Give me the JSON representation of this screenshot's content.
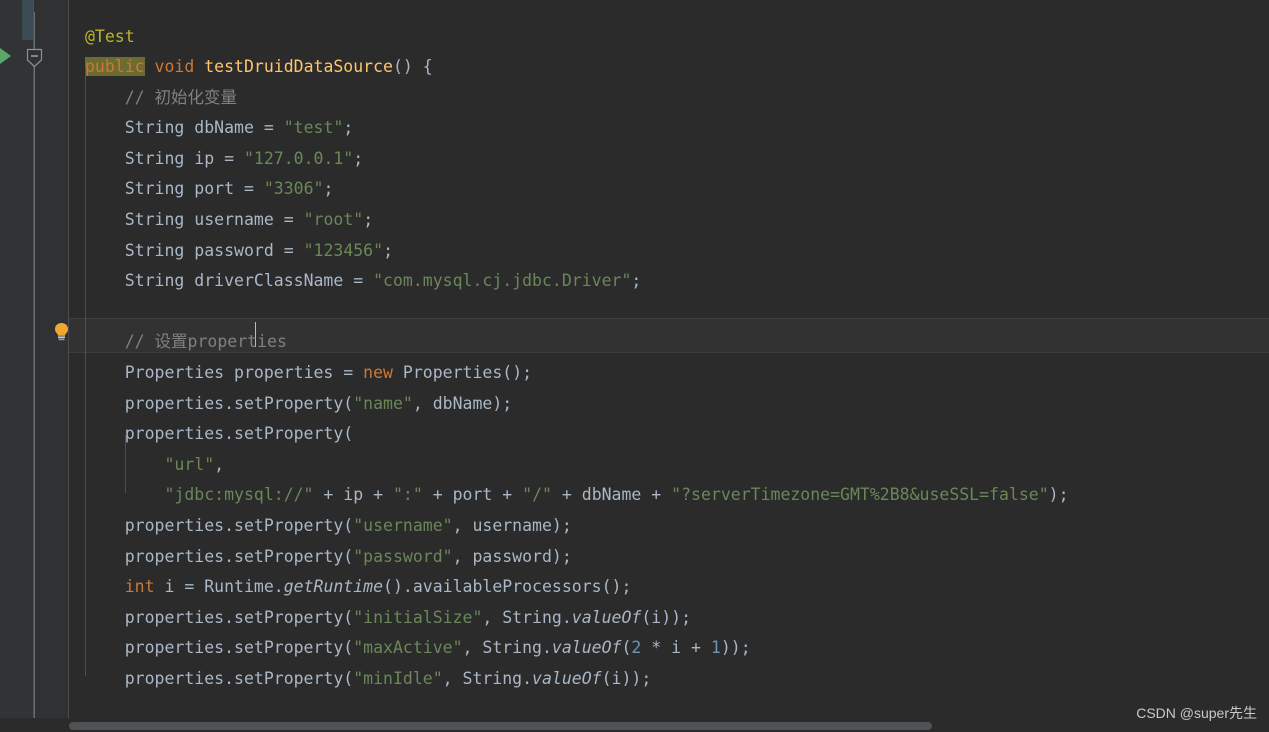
{
  "app": {
    "name": "IntelliJ IDEA Editor",
    "theme": "Darcula",
    "language": "Java"
  },
  "watermark": {
    "text": "CSDN @super先生"
  },
  "gutter": {
    "run_marker": "run-test-gutter-icon",
    "fold_marker": "collapse-method-fold-icon",
    "intention_bulb": "intention-lightbulb-icon",
    "annotation_block": "vcs-change-marker"
  },
  "caret": {
    "line_text": "    // 设置properties",
    "column_after": "properties"
  },
  "editor": {
    "lines": [
      {
        "n": 1,
        "indent": 0,
        "tokens": [
          {
            "t": "@Test",
            "c": "anno"
          }
        ]
      },
      {
        "n": 2,
        "indent": 0,
        "tokens": [
          {
            "t": "public",
            "c": "kw hl"
          },
          {
            "t": " ",
            "c": "plain"
          },
          {
            "t": "void",
            "c": "kw"
          },
          {
            "t": " ",
            "c": "plain"
          },
          {
            "t": "testDruidDataSource",
            "c": "mname"
          },
          {
            "t": "()",
            "c": "paren"
          },
          {
            "t": " {",
            "c": "plain"
          }
        ]
      },
      {
        "n": 3,
        "indent": 1,
        "tokens": [
          {
            "t": "// 初始化变量",
            "c": "cmt"
          }
        ]
      },
      {
        "n": 4,
        "indent": 1,
        "tokens": [
          {
            "t": "String",
            "c": "type"
          },
          {
            "t": " dbName = ",
            "c": "plain"
          },
          {
            "t": "\"test\"",
            "c": "str"
          },
          {
            "t": ";",
            "c": "plain"
          }
        ]
      },
      {
        "n": 5,
        "indent": 1,
        "tokens": [
          {
            "t": "String",
            "c": "type"
          },
          {
            "t": " ip = ",
            "c": "plain"
          },
          {
            "t": "\"127.0.0.1\"",
            "c": "str"
          },
          {
            "t": ";",
            "c": "plain"
          }
        ]
      },
      {
        "n": 6,
        "indent": 1,
        "tokens": [
          {
            "t": "String",
            "c": "type"
          },
          {
            "t": " port = ",
            "c": "plain"
          },
          {
            "t": "\"3306\"",
            "c": "str"
          },
          {
            "t": ";",
            "c": "plain"
          }
        ]
      },
      {
        "n": 7,
        "indent": 1,
        "tokens": [
          {
            "t": "String",
            "c": "type"
          },
          {
            "t": " username = ",
            "c": "plain"
          },
          {
            "t": "\"root\"",
            "c": "str"
          },
          {
            "t": ";",
            "c": "plain"
          }
        ]
      },
      {
        "n": 8,
        "indent": 1,
        "tokens": [
          {
            "t": "String",
            "c": "type"
          },
          {
            "t": " password = ",
            "c": "plain"
          },
          {
            "t": "\"123456\"",
            "c": "str"
          },
          {
            "t": ";",
            "c": "plain"
          }
        ]
      },
      {
        "n": 9,
        "indent": 1,
        "tokens": [
          {
            "t": "String",
            "c": "type"
          },
          {
            "t": " driverClassName = ",
            "c": "plain"
          },
          {
            "t": "\"com.mysql.cj.jdbc.Driver\"",
            "c": "str"
          },
          {
            "t": ";",
            "c": "plain"
          }
        ]
      },
      {
        "n": 10,
        "indent": 1,
        "tokens": []
      },
      {
        "n": 11,
        "indent": 1,
        "tokens": [
          {
            "t": "// 设置properties",
            "c": "cmt"
          }
        ]
      },
      {
        "n": 12,
        "indent": 1,
        "tokens": [
          {
            "t": "Properties",
            "c": "type"
          },
          {
            "t": " properties = ",
            "c": "plain"
          },
          {
            "t": "new",
            "c": "kw"
          },
          {
            "t": " Properties",
            "c": "plain"
          },
          {
            "t": "()",
            "c": "paren"
          },
          {
            "t": ";",
            "c": "plain"
          }
        ]
      },
      {
        "n": 13,
        "indent": 1,
        "tokens": [
          {
            "t": "properties.setProperty",
            "c": "plain"
          },
          {
            "t": "(",
            "c": "paren"
          },
          {
            "t": "\"name\"",
            "c": "str"
          },
          {
            "t": ", dbName",
            "c": "plain"
          },
          {
            "t": ")",
            "c": "paren"
          },
          {
            "t": ";",
            "c": "plain"
          }
        ]
      },
      {
        "n": 14,
        "indent": 1,
        "tokens": [
          {
            "t": "properties.setProperty",
            "c": "plain"
          },
          {
            "t": "(",
            "c": "paren"
          }
        ]
      },
      {
        "n": 15,
        "indent": 2,
        "tokens": [
          {
            "t": "\"url\"",
            "c": "str"
          },
          {
            "t": ",",
            "c": "plain"
          }
        ]
      },
      {
        "n": 16,
        "indent": 2,
        "tokens": [
          {
            "t": "\"jdbc:mysql://\"",
            "c": "str"
          },
          {
            "t": " + ip + ",
            "c": "plain"
          },
          {
            "t": "\":\"",
            "c": "str"
          },
          {
            "t": " + port + ",
            "c": "plain"
          },
          {
            "t": "\"/\"",
            "c": "str"
          },
          {
            "t": " + dbName + ",
            "c": "plain"
          },
          {
            "t": "\"?serverTimezone=GMT%2B8&useSSL=false\"",
            "c": "str"
          },
          {
            "t": ")",
            "c": "paren"
          },
          {
            "t": ";",
            "c": "plain"
          }
        ]
      },
      {
        "n": 17,
        "indent": 1,
        "tokens": [
          {
            "t": "properties.setProperty",
            "c": "plain"
          },
          {
            "t": "(",
            "c": "paren"
          },
          {
            "t": "\"username\"",
            "c": "str"
          },
          {
            "t": ", username",
            "c": "plain"
          },
          {
            "t": ")",
            "c": "paren"
          },
          {
            "t": ";",
            "c": "plain"
          }
        ]
      },
      {
        "n": 18,
        "indent": 1,
        "tokens": [
          {
            "t": "properties.setProperty",
            "c": "plain"
          },
          {
            "t": "(",
            "c": "paren"
          },
          {
            "t": "\"password\"",
            "c": "str"
          },
          {
            "t": ", password",
            "c": "plain"
          },
          {
            "t": ")",
            "c": "paren"
          },
          {
            "t": ";",
            "c": "plain"
          }
        ]
      },
      {
        "n": 19,
        "indent": 1,
        "tokens": [
          {
            "t": "int",
            "c": "kw"
          },
          {
            "t": " i = Runtime.",
            "c": "plain"
          },
          {
            "t": "getRuntime",
            "c": "stat"
          },
          {
            "t": "()",
            "c": "paren"
          },
          {
            "t": ".availableProcessors",
            "c": "plain"
          },
          {
            "t": "()",
            "c": "paren"
          },
          {
            "t": ";",
            "c": "plain"
          }
        ]
      },
      {
        "n": 20,
        "indent": 1,
        "tokens": [
          {
            "t": "properties.setProperty",
            "c": "plain"
          },
          {
            "t": "(",
            "c": "paren"
          },
          {
            "t": "\"initialSize\"",
            "c": "str"
          },
          {
            "t": ", String.",
            "c": "plain"
          },
          {
            "t": "valueOf",
            "c": "stat"
          },
          {
            "t": "(",
            "c": "paren"
          },
          {
            "t": "i",
            "c": "plain"
          },
          {
            "t": "))",
            "c": "paren"
          },
          {
            "t": ";",
            "c": "plain"
          }
        ]
      },
      {
        "n": 21,
        "indent": 1,
        "tokens": [
          {
            "t": "properties.setProperty",
            "c": "plain"
          },
          {
            "t": "(",
            "c": "paren"
          },
          {
            "t": "\"maxActive\"",
            "c": "str"
          },
          {
            "t": ", String.",
            "c": "plain"
          },
          {
            "t": "valueOf",
            "c": "stat"
          },
          {
            "t": "(",
            "c": "paren"
          },
          {
            "t": "2",
            "c": "num"
          },
          {
            "t": " * i + ",
            "c": "plain"
          },
          {
            "t": "1",
            "c": "num"
          },
          {
            "t": "))",
            "c": "paren"
          },
          {
            "t": ";",
            "c": "plain"
          }
        ]
      },
      {
        "n": 22,
        "indent": 1,
        "tokens": [
          {
            "t": "properties.setProperty",
            "c": "plain"
          },
          {
            "t": "(",
            "c": "paren"
          },
          {
            "t": "\"minIdle\"",
            "c": "str"
          },
          {
            "t": ", String.",
            "c": "plain"
          },
          {
            "t": "valueOf",
            "c": "stat"
          },
          {
            "t": "(",
            "c": "paren"
          },
          {
            "t": "i",
            "c": "plain"
          },
          {
            "t": "))",
            "c": "paren"
          },
          {
            "t": ";",
            "c": "plain"
          }
        ]
      }
    ]
  },
  "colors": {
    "background": "#2b2b2b",
    "gutter": "#2f3133",
    "left_strip": "#313335",
    "keyword": "#cc7832",
    "annotation": "#bbb529",
    "method_name": "#ffc66d",
    "identifier": "#a9b7c6",
    "string": "#6a8759",
    "number": "#6897bb",
    "comment": "#808080",
    "caret_highlight": "#6b6b32",
    "current_line": "#323232",
    "run_marker_green": "#59a869",
    "bulb_yellow": "#f0a732"
  }
}
